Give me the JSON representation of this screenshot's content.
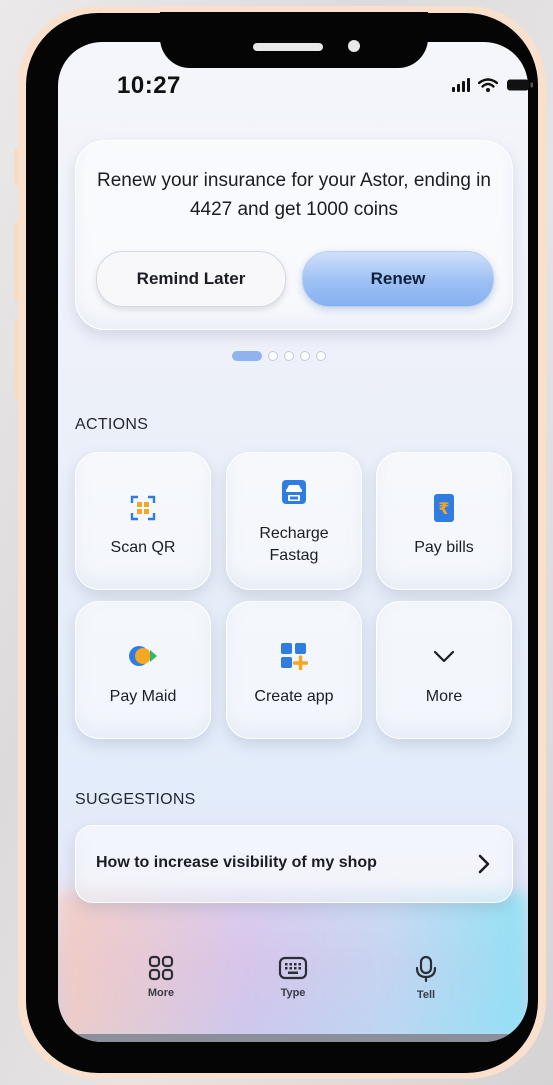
{
  "status_bar": {
    "time": "10:27"
  },
  "promo_card": {
    "message": "Renew your insurance for your Astor, ending in 4427 and get 1000 coins",
    "remind_label": "Remind Later",
    "renew_label": "Renew",
    "pager": {
      "total": 5,
      "active_index": 0
    }
  },
  "actions": {
    "title": "ACTIONS",
    "items": [
      {
        "label": "Scan QR",
        "icon": "qr-scan-icon"
      },
      {
        "label": "Recharge Fastag",
        "icon": "fastag-car-card-icon"
      },
      {
        "label": "Pay bills",
        "icon": "rupee-bill-icon"
      },
      {
        "label": "Pay Maid",
        "icon": "coin-send-icon"
      },
      {
        "label": "Create app",
        "icon": "app-grid-plus-icon"
      },
      {
        "label": "More",
        "icon": "chevron-down-icon"
      }
    ]
  },
  "suggestions": {
    "title": "SUGGESTIONS",
    "items": [
      {
        "label": "How to increase visibility of my shop"
      }
    ]
  },
  "bottom_nav": {
    "items": [
      {
        "label": "More",
        "icon": "grid-icon"
      },
      {
        "label": "Type",
        "icon": "keyboard-icon"
      },
      {
        "label": "Tell",
        "icon": "microphone-icon"
      }
    ]
  },
  "colors": {
    "accent": "#8fb3ee",
    "frame": "#f8e0cc",
    "rupee_orange": "#f5a623",
    "icon_blue": "#2f7de1"
  }
}
